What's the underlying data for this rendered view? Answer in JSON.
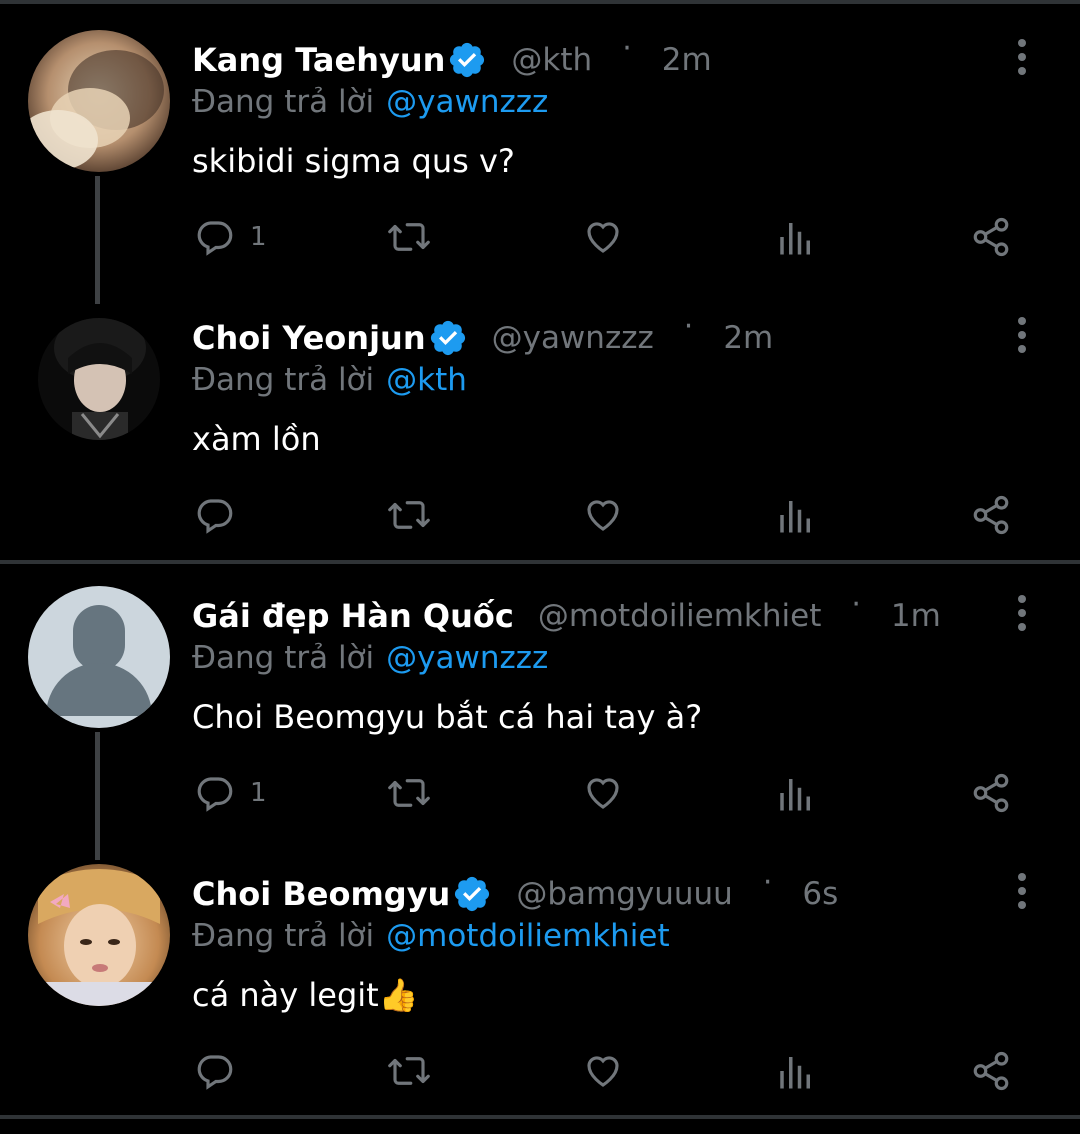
{
  "colors": {
    "background": "#000000",
    "text": "#ffffff",
    "muted": "#71767b",
    "accent": "#1d9bf0",
    "divider": "#2f3336"
  },
  "reply_prefix": "Đang trả lời",
  "tweets": [
    {
      "name": "Kang Taehyun",
      "verified": true,
      "handle": "@kth",
      "dot": "·",
      "time": "2m",
      "replying_to": "@yawnzzz",
      "text": "skibidi sigma qus v?",
      "reply_count": "1",
      "avatar": "photo"
    },
    {
      "name": "Choi Yeonjun",
      "verified": true,
      "handle": "@yawnzzz",
      "dot": "·",
      "time": "2m",
      "replying_to": "@kth",
      "text": "xàm lồn",
      "reply_count": "",
      "avatar": "photo"
    },
    {
      "name": "Gái đẹp Hàn Quốc",
      "verified": false,
      "handle": "@motdoiliemkhiet",
      "dot": "·",
      "time": "1m",
      "replying_to": "@yawnzzz",
      "text": "Choi Beomgyu bắt cá hai tay à?",
      "reply_count": "1",
      "avatar": "default"
    },
    {
      "name": "Choi Beomgyu",
      "verified": true,
      "handle": "@bamgyuuuu",
      "dot": "·",
      "time": "6s",
      "replying_to": "@motdoiliemkhiet",
      "text": "cá này legit👍",
      "reply_count": "",
      "avatar": "photo"
    }
  ],
  "icons": [
    "reply-icon",
    "retweet-icon",
    "like-icon",
    "views-icon",
    "share-icon",
    "more-icon",
    "verified-icon"
  ]
}
